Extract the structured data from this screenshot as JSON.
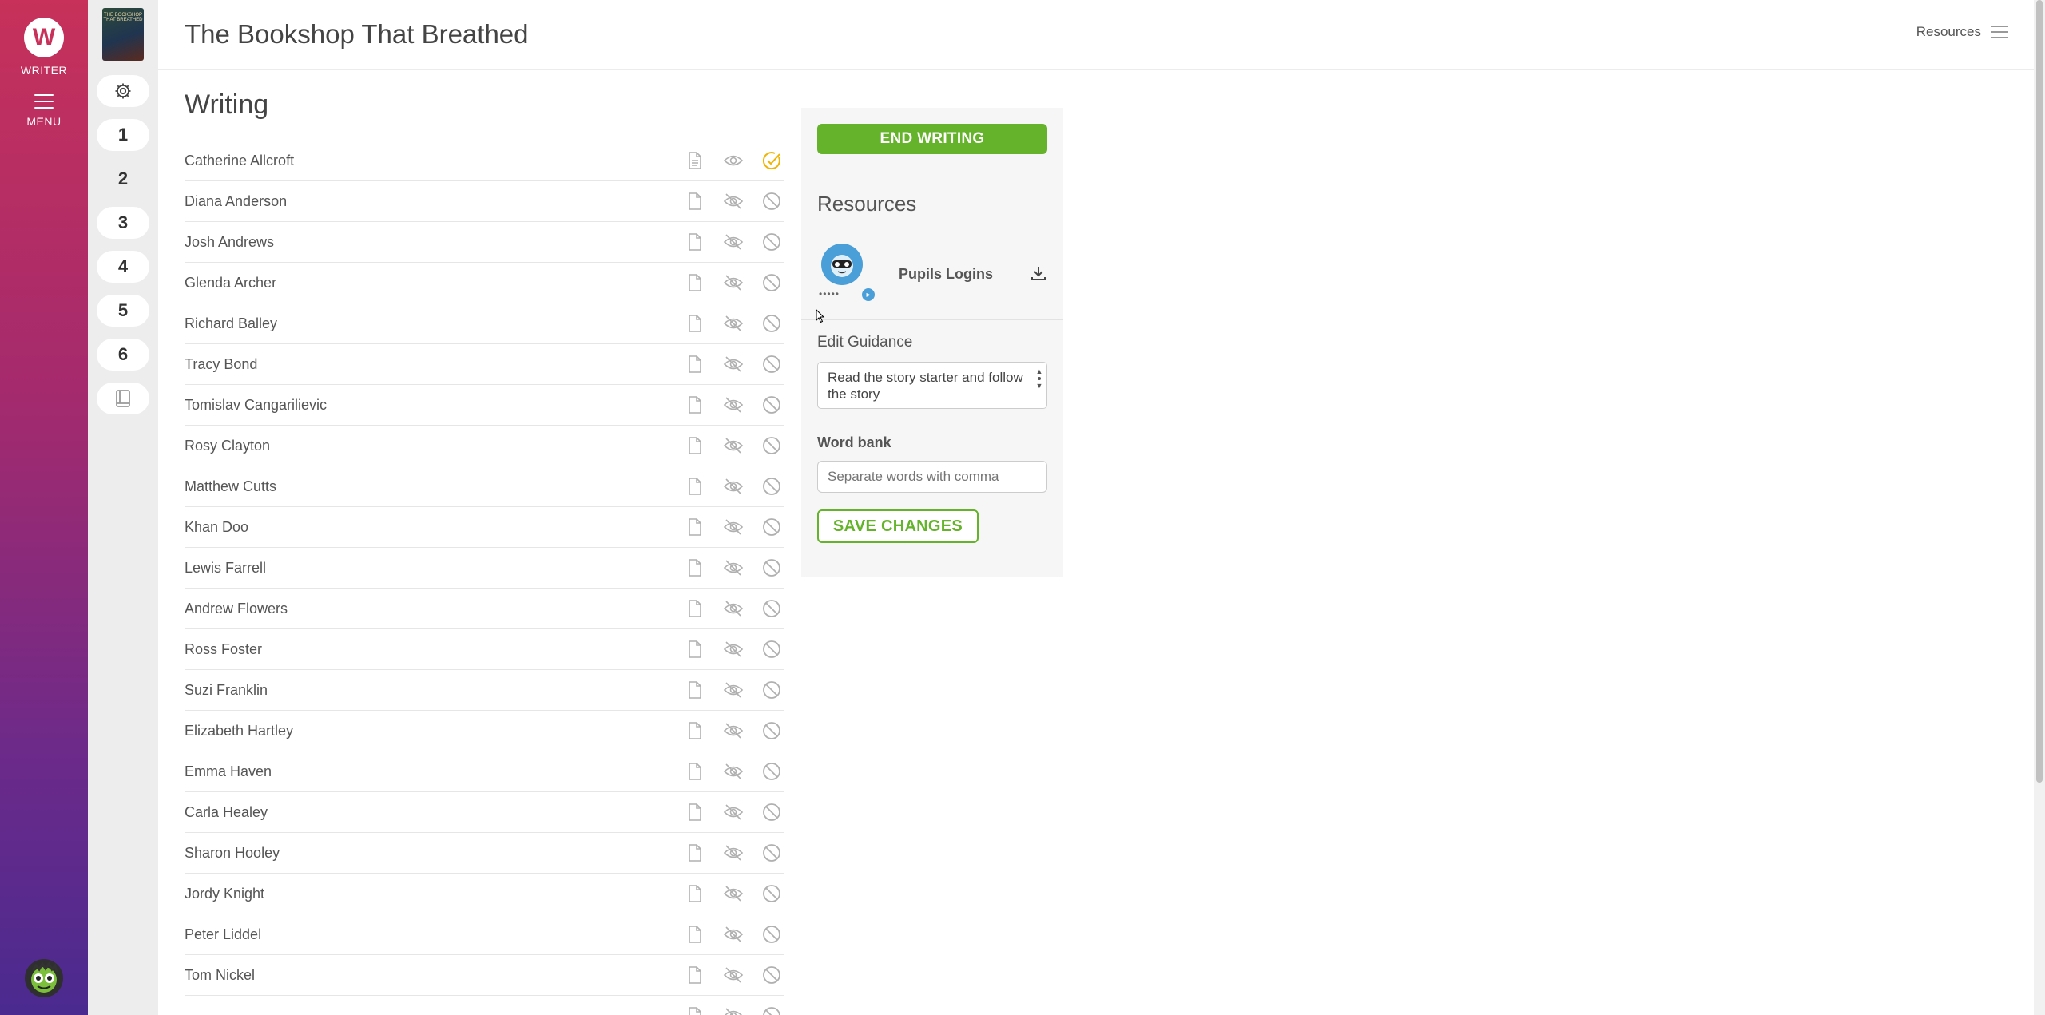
{
  "rail": {
    "logo_letter": "W",
    "logo_label": "WRITER",
    "menu_label": "MENU"
  },
  "sidebar": {
    "book_cover_text": "THE BOOKSHOP THAT BREATHED",
    "steps": [
      "1",
      "2",
      "3",
      "4",
      "5",
      "6"
    ],
    "active_step": "2"
  },
  "header": {
    "title": "The Bookshop That Breathed",
    "resources_link": "Resources"
  },
  "writing": {
    "heading": "Writing",
    "pupils": [
      {
        "name": "Catherine Allcroft",
        "status": "active"
      },
      {
        "name": "Diana Anderson",
        "status": "inactive"
      },
      {
        "name": "Josh Andrews",
        "status": "inactive"
      },
      {
        "name": "Glenda Archer",
        "status": "inactive"
      },
      {
        "name": "Richard Balley",
        "status": "inactive"
      },
      {
        "name": "Tracy Bond",
        "status": "inactive"
      },
      {
        "name": "Tomislav Cangarilievic",
        "status": "inactive"
      },
      {
        "name": "Rosy Clayton",
        "status": "inactive"
      },
      {
        "name": "Matthew Cutts",
        "status": "inactive"
      },
      {
        "name": "Khan Doo",
        "status": "inactive"
      },
      {
        "name": "Lewis Farrell",
        "status": "inactive"
      },
      {
        "name": "Andrew Flowers",
        "status": "inactive"
      },
      {
        "name": "Ross Foster",
        "status": "inactive"
      },
      {
        "name": "Suzi Franklin",
        "status": "inactive"
      },
      {
        "name": "Elizabeth Hartley",
        "status": "inactive"
      },
      {
        "name": "Emma Haven",
        "status": "inactive"
      },
      {
        "name": "Carla Healey",
        "status": "inactive"
      },
      {
        "name": "Sharon Hooley",
        "status": "inactive"
      },
      {
        "name": "Jordy Knight",
        "status": "inactive"
      },
      {
        "name": "Peter Liddel",
        "status": "inactive"
      },
      {
        "name": "Tom Nickel",
        "status": "inactive"
      },
      {
        "name": "",
        "status": "inactive"
      }
    ]
  },
  "panel": {
    "end_button": "END WRITING",
    "resources_heading": "Resources",
    "resource_name": "Pupils Logins",
    "resource_dots": "•••••",
    "edit_guidance_label": "Edit Guidance",
    "guidance_text": "Read the story starter and follow the story",
    "word_bank_label": "Word bank",
    "word_bank_placeholder": "Separate words with comma",
    "save_button": "SAVE CHANGES"
  },
  "colors": {
    "accent_green": "#64b32a",
    "active_check": "#f0b400",
    "rail_top": "#c7315a",
    "rail_bottom": "#4a2a8f"
  }
}
